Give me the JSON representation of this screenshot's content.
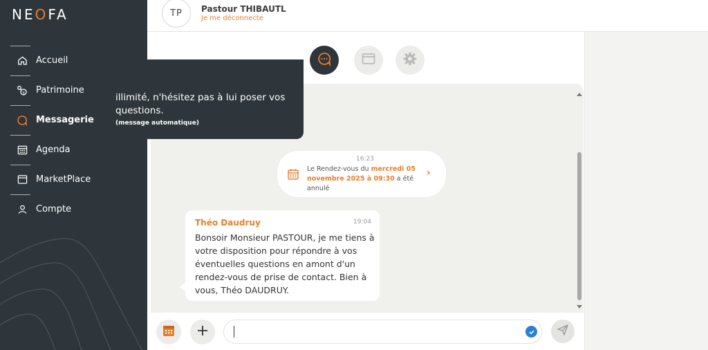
{
  "brand": {
    "logo_text_pre": "NE",
    "logo_text_o": "O",
    "logo_text_post": "FA",
    "accent": "#e97d2b",
    "sidebar_bg": "#2e363b"
  },
  "sidebar": {
    "items": [
      {
        "label": "Accueil",
        "icon": "home-icon"
      },
      {
        "label": "Patrimoine",
        "icon": "patrimoine-icon"
      },
      {
        "label": "Messagerie",
        "icon": "chat-icon",
        "active": true
      },
      {
        "label": "Agenda",
        "icon": "calendar-icon"
      },
      {
        "label": "MarketPlace",
        "icon": "browser-window-icon"
      },
      {
        "label": "Compte",
        "icon": "user-icon"
      }
    ]
  },
  "header": {
    "avatar_initials": "TP",
    "user_name": "Pastour THIBAUTL",
    "logout_label": "Je me déconnecte"
  },
  "tabs": [
    {
      "name": "messages",
      "icon": "chat-bubble-icon",
      "active": true
    },
    {
      "name": "documents",
      "icon": "folder-icon",
      "active": false
    },
    {
      "name": "settings",
      "icon": "gear-icon",
      "active": false
    }
  ],
  "messages": {
    "auto_message": {
      "text": "illimité, n'hésitez pas à lui poser vos questions.",
      "note": "(message automatique)"
    },
    "appointment": {
      "time": "16:23",
      "text_before": "Le Rendez-vous du ",
      "date_highlight": "mercredi 05 novembre 2025 à 09:30",
      "text_after": " a été annulé"
    },
    "advisor_message": {
      "sender": "Théo Daudruy",
      "time": "19:04",
      "text": "Bonsoir Monsieur PASTOUR, je me tiens à votre disposition pour répondre à vos éventuelles questions en amont d'un rendez-vous de prise de contact. Bien à vous, Théo DAUDRUY."
    }
  },
  "composer": {
    "input_value": "",
    "calendar_button_icon": "calendar-icon",
    "add_button_icon": "plus-icon",
    "send_button_icon": "send-icon",
    "check_icon": "check-circle-icon"
  }
}
